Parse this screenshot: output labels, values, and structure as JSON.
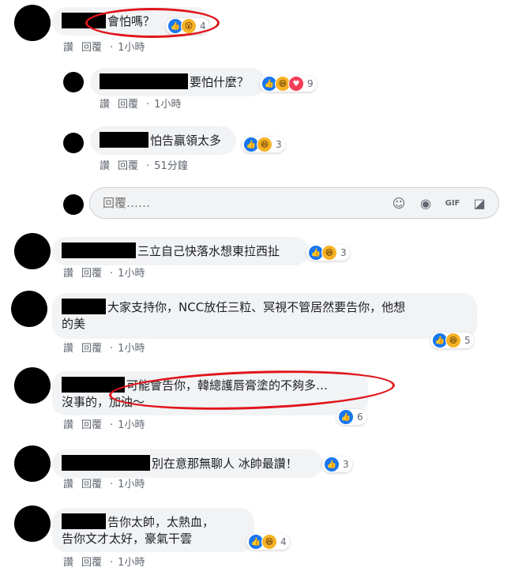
{
  "labels": {
    "like": "讚",
    "reply": "回覆",
    "dot": "·"
  },
  "reply_placeholder": "回覆……",
  "comments": [
    {
      "text": "會怕嗎？",
      "time": "1小時",
      "react_count": "4"
    },
    {
      "text": "要怕什麼？",
      "time": "1小時",
      "react_count": "9"
    },
    {
      "text": "怕告贏領太多",
      "time": "51分鐘",
      "react_count": "3"
    },
    {
      "text": "三立自己快落水想東拉西扯",
      "time": "1小時",
      "react_count": "3"
    },
    {
      "text_line1": "大家支持你，NCC放任三粒、冥視不管居然要告你，他想",
      "text_line2": "的美",
      "time": "1小時",
      "react_count": "5"
    },
    {
      "text_line1": "可能會告你，韓總護唇膏塗的不夠多…",
      "text_line2": "沒事的，加油～",
      "time": "1小時",
      "react_count": "6"
    },
    {
      "text": "別在意那無聊人 冰帥最讚！",
      "time": "1小時",
      "react_count": "3"
    },
    {
      "text_line1": "告你太帥，太熱血，",
      "text_line2": "告你文才太好，豪氣干雲",
      "time": "1小時",
      "react_count": "4"
    }
  ]
}
